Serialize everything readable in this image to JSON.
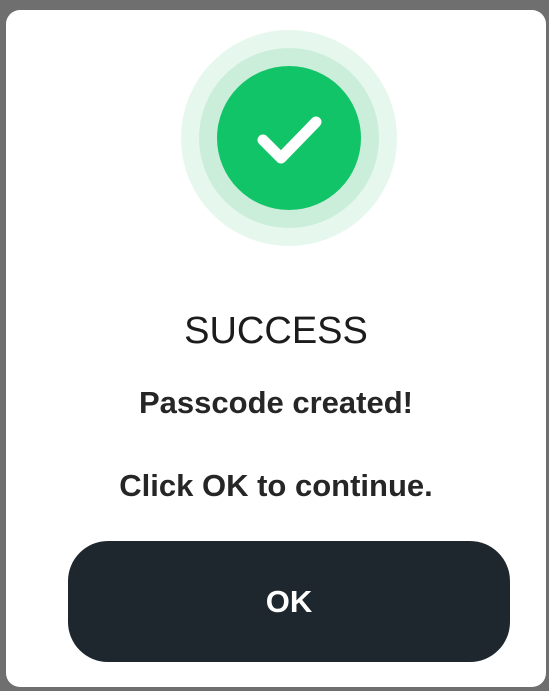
{
  "dialog": {
    "icon": "checkmark-icon",
    "title": "SUCCESS",
    "message": "Passcode created!",
    "instruction": "Click OK to continue.",
    "ok_label": "OK"
  },
  "colors": {
    "success_green": "#12c468",
    "halo_light": "#e6f8ee",
    "halo_mid": "#cbeedb",
    "button_dark": "#1e272e"
  }
}
